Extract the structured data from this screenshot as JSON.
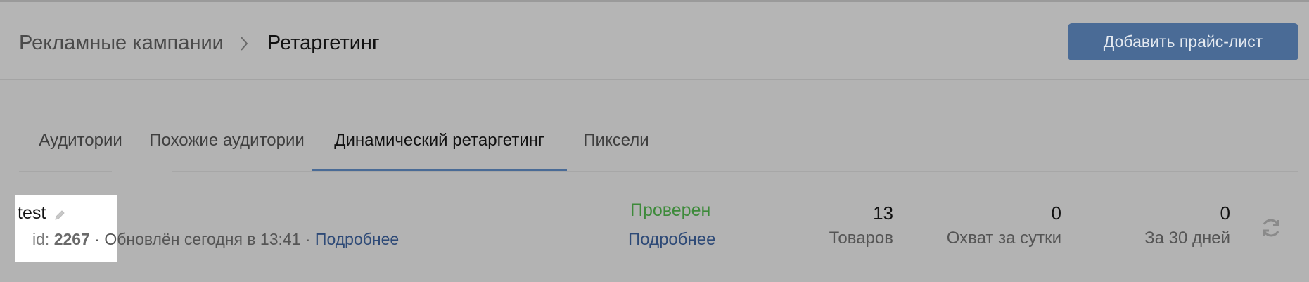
{
  "header": {
    "breadcrumb": {
      "parent": "Рекламные кампании",
      "current": "Ретаргетинг"
    },
    "add_button_label": "Добавить прайс-лист"
  },
  "tabs": [
    {
      "label": "Аудитории",
      "active": false
    },
    {
      "label": "Похожие аудитории",
      "active": false
    },
    {
      "label": "Динамический ретаргетинг",
      "active": true
    },
    {
      "label": "Пиксели",
      "active": false
    }
  ],
  "pricelist": {
    "name": "test",
    "id_label": "id:",
    "id_value": "2267",
    "sep": "·",
    "updated_text": "Обновлён сегодня в 13:41",
    "details_link": "Подробнее",
    "status": "Проверен",
    "status_link": "Подробнее",
    "metrics": [
      {
        "value": "13",
        "label": "Товаров"
      },
      {
        "value": "0",
        "label": "Охват за сутки"
      },
      {
        "value": "0",
        "label": "За 30 дней"
      }
    ]
  },
  "colors": {
    "accent": "#4a6b96",
    "link": "#2e4a77",
    "status_ok": "#3d8a3a"
  },
  "icons": {
    "breadcrumb_separator": "chevron-right-icon",
    "edit": "pencil-icon",
    "refresh": "refresh-icon"
  }
}
